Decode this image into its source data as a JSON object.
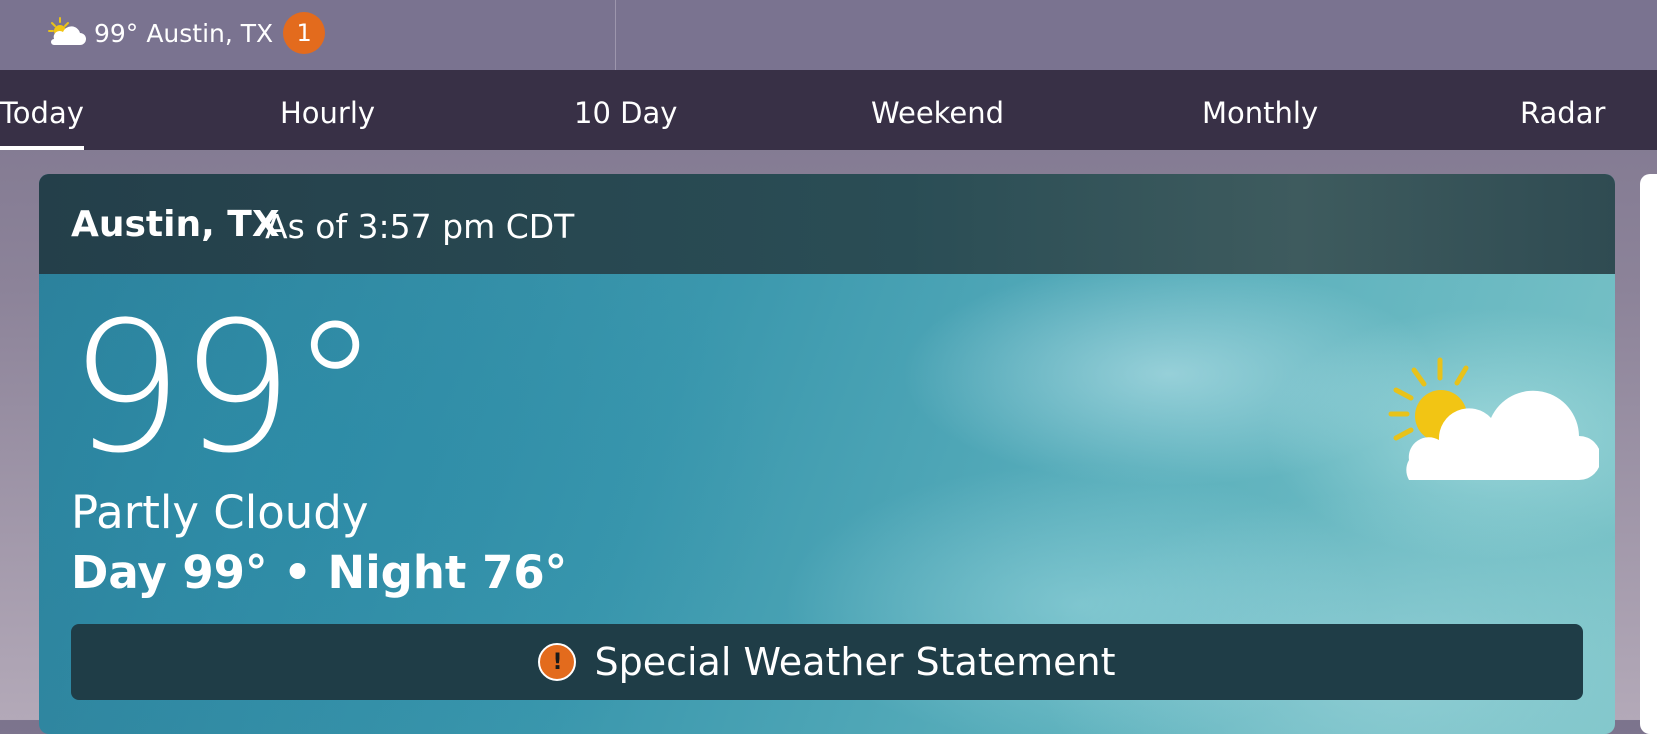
{
  "topbar": {
    "temp": "99°",
    "location": "Austin, TX",
    "badge_count": "1",
    "icon": "partly-cloudy-icon"
  },
  "tabs": [
    {
      "label": "Today",
      "active": true
    },
    {
      "label": "Hourly"
    },
    {
      "label": "10 Day"
    },
    {
      "label": "Weekend"
    },
    {
      "label": "Monthly"
    },
    {
      "label": "Radar"
    }
  ],
  "current": {
    "location": "Austin, TX",
    "as_of": "As of 3:57 pm CDT",
    "temperature": "99°",
    "condition": "Partly Cloudy",
    "day_night": "Day 99° • Night 76°",
    "icon": "partly-cloudy-icon"
  },
  "alert": {
    "label": "Special Weather Statement",
    "icon": "alert-icon",
    "icon_glyph": "!"
  },
  "colors": {
    "accent_orange": "#e36b1d",
    "tab_bar": "#383046",
    "top_bar": "#7a7390"
  }
}
